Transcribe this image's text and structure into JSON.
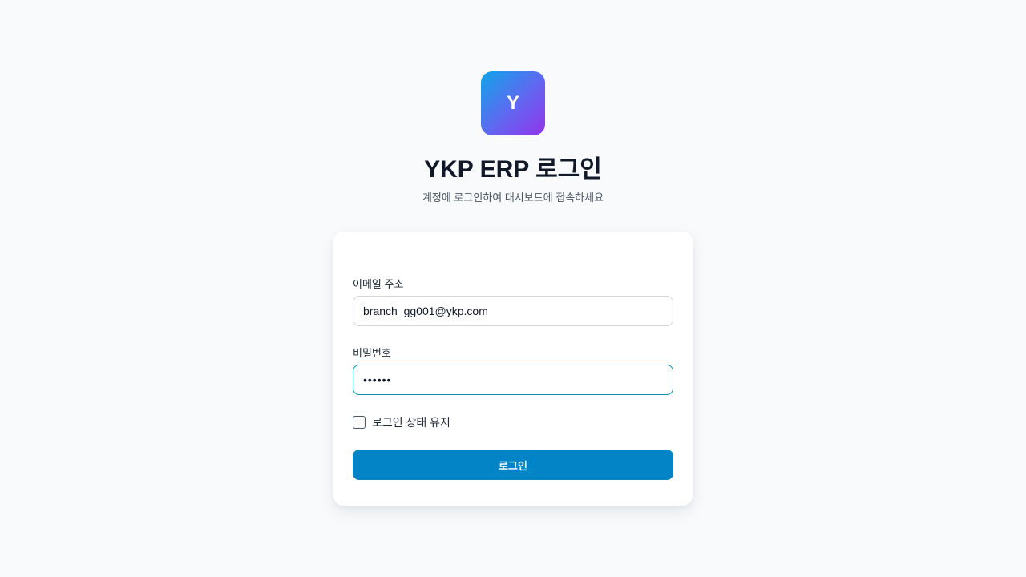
{
  "logo": {
    "letter": "Y"
  },
  "header": {
    "title": "YKP ERP 로그인",
    "subtitle": "계정에 로그인하여 대시보드에 접속하세요"
  },
  "form": {
    "email_label": "이메일 주소",
    "email_value": "branch_gg001@ykp.com",
    "password_label": "비밀번호",
    "password_value": "••••••",
    "remember_label": "로그인 상태 유지",
    "remember_checked": false,
    "submit_label": "로그인"
  },
  "colors": {
    "background": "#f8fafc",
    "primary_button": "#0284c7",
    "focus_border": "#0891b2",
    "logo_gradient_start": "#0ea5e9",
    "logo_gradient_end": "#9333ea"
  }
}
